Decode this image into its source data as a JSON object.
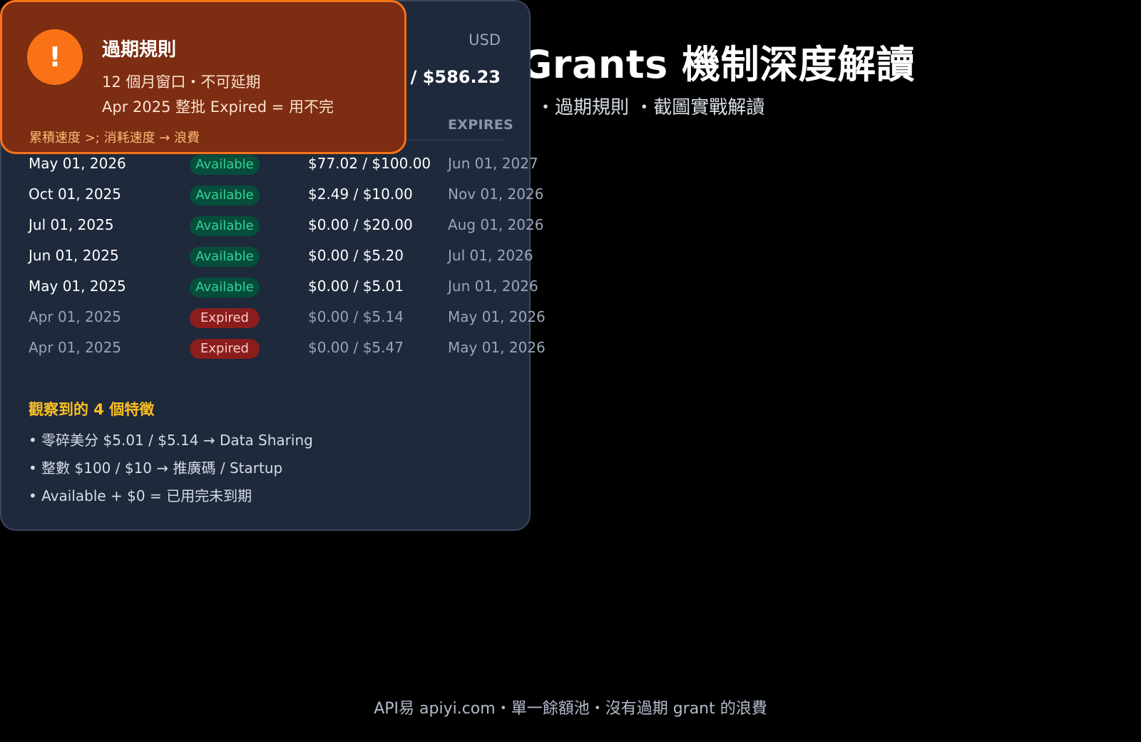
{
  "background": {
    "title": "Grants 機制深度解讀",
    "subtitle": "・過期規則 ・截圖實戰解讀"
  },
  "card": {
    "currency": "USD",
    "total": "72 / $586.23",
    "expires_header": "EXPIRES",
    "rows": [
      {
        "date": "May 01,   2026",
        "status": "Available",
        "amount": "$77.02 / $100.00",
        "expires": "Jun 01,   2027"
      },
      {
        "date": "Oct 01,   2025",
        "status": "Available",
        "amount": "$2.49 / $10.00",
        "expires": "Nov 01,   2026"
      },
      {
        "date": "Jul 01,   2025",
        "status": "Available",
        "amount": "$0.00 / $20.00",
        "expires": "Aug 01,   2026"
      },
      {
        "date": "Jun 01,   2025",
        "status": "Available",
        "amount": "$0.00 / $5.20",
        "expires": "Jul 01,   2026"
      },
      {
        "date": "May 01,   2025",
        "status": "Available",
        "amount": "$0.00 / $5.01",
        "expires": "Jun 01,   2026"
      },
      {
        "date": "Apr 01,   2025",
        "status": "Expired",
        "amount": "$0.00 / $5.14",
        "expires": "May 01,   2026"
      },
      {
        "date": "Apr 01,   2025",
        "status": "Expired",
        "amount": "$0.00 / $5.47",
        "expires": "May 01,   2026"
      }
    ],
    "features_title": "觀察到的 4 個特徵",
    "features": [
      "• 零碎美分 $5.01 / $5.14 → Data Sharing",
      "• 整數 $100 / $10 → 推廣碼 / Startup",
      "• Available + $0 = 已用完未到期"
    ]
  },
  "popup": {
    "icon": "!",
    "title": "過期規則",
    "line1": "12 個月窗口・不可延期",
    "line2": "Apr 2025 整批 Expired = 用不完",
    "footer": "累積速度 >;  消耗速度 → 浪費"
  },
  "footer": "API易 apiyi.com・單一餘額池・沒有過期 grant 的浪費",
  "colors": {
    "available": "#34d399",
    "expired": "#ef4444",
    "accent_orange": "#f97316",
    "features_title": "#fbbf24"
  }
}
